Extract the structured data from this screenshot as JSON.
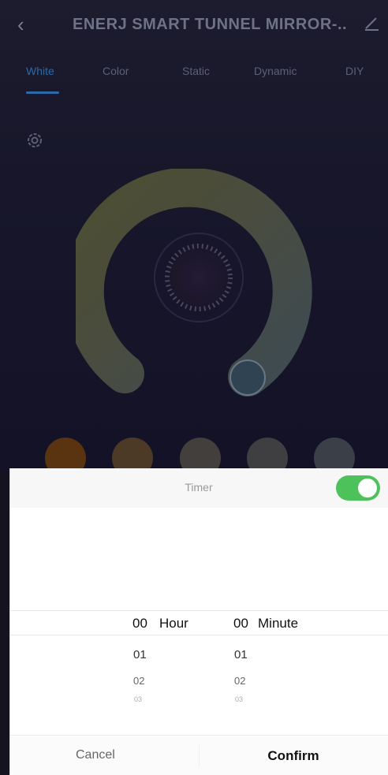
{
  "header": {
    "title": "ENERJ SMART TUNNEL MIRROR-..",
    "back_icon": "chevron-left-icon",
    "edit_icon": "pencil-icon"
  },
  "tabs": [
    {
      "label": "White",
      "active": true
    },
    {
      "label": "Color",
      "active": false
    },
    {
      "label": "Static",
      "active": false
    },
    {
      "label": "Dynamic",
      "active": false
    },
    {
      "label": "DIY",
      "active": false
    }
  ],
  "settings_icon": "gear-icon",
  "swatches": [
    "#c86b26",
    "#9a6a3d",
    "#8a8480",
    "#8c8c8e",
    "#7c8898"
  ],
  "timer": {
    "label": "Timer",
    "enabled": true,
    "accent_color": "#4ec25a",
    "hour": {
      "selected": "00",
      "unit": "Hour",
      "options": [
        "01",
        "02",
        "03"
      ]
    },
    "minute": {
      "selected": "00",
      "unit": "Minute",
      "options": [
        "01",
        "02",
        "03"
      ]
    },
    "cancel_label": "Cancel",
    "confirm_label": "Confirm"
  }
}
